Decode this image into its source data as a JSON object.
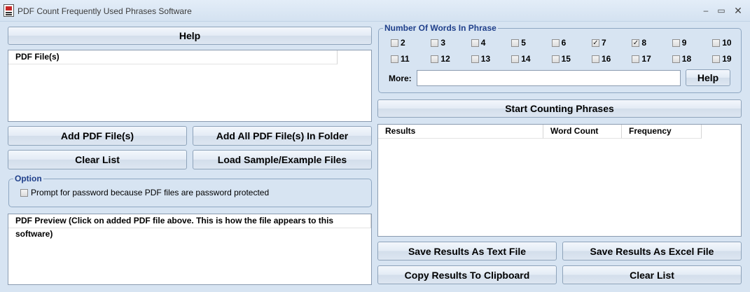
{
  "window": {
    "title": "PDF Count Frequently Used Phrases Software",
    "minimize": "–",
    "maximize": "▭",
    "close": "✕"
  },
  "left": {
    "help_button": "Help",
    "file_list": {
      "column": "PDF File(s)"
    },
    "add_files_button": "Add PDF File(s)",
    "add_folder_button": "Add All PDF File(s) In Folder",
    "clear_list_button": "Clear List",
    "load_sample_button": "Load Sample/Example Files",
    "option": {
      "title": "Option",
      "password_label": "Prompt for password because PDF files are password protected",
      "password_checked": false
    },
    "preview": {
      "column": "PDF Preview (Click on added PDF file above. This is how the file appears to this software)"
    }
  },
  "right": {
    "words_group": {
      "title": "Number Of Words In Phrase",
      "options": [
        {
          "label": "2",
          "checked": false
        },
        {
          "label": "3",
          "checked": false
        },
        {
          "label": "4",
          "checked": false
        },
        {
          "label": "5",
          "checked": false
        },
        {
          "label": "6",
          "checked": false
        },
        {
          "label": "7",
          "checked": true
        },
        {
          "label": "8",
          "checked": true
        },
        {
          "label": "9",
          "checked": false
        },
        {
          "label": "10",
          "checked": false
        },
        {
          "label": "11",
          "checked": false
        },
        {
          "label": "12",
          "checked": false
        },
        {
          "label": "13",
          "checked": false
        },
        {
          "label": "14",
          "checked": false
        },
        {
          "label": "15",
          "checked": false
        },
        {
          "label": "16",
          "checked": false
        },
        {
          "label": "17",
          "checked": false
        },
        {
          "label": "18",
          "checked": false
        },
        {
          "label": "19",
          "checked": false
        }
      ],
      "more_label": "More:",
      "more_value": "",
      "help_button": "Help"
    },
    "start_button": "Start Counting Phrases",
    "results": {
      "columns": [
        "Results",
        "Word Count",
        "Frequency"
      ]
    },
    "save_text_button": "Save Results As Text File",
    "save_excel_button": "Save Results As Excel File",
    "copy_button": "Copy Results To Clipboard",
    "clear_list_button": "Clear List"
  }
}
